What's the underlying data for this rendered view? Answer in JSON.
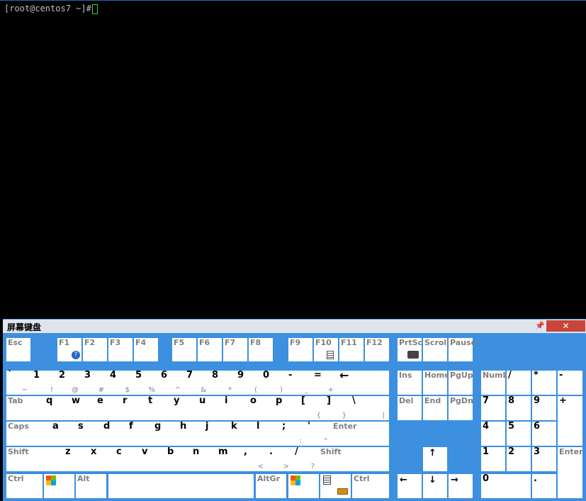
{
  "terminal": {
    "prompt": "[root@centos7 ~]#"
  },
  "osk": {
    "title": "屏幕键盘",
    "pin_icon": "📌",
    "close_icon": "✕",
    "colors": {
      "background": "#3d8fe0",
      "key": "#ffffff",
      "key_text": "#7f7f7f",
      "close": "#c7453a"
    },
    "keys": {
      "esc": "Esc",
      "f1": "F1",
      "f2": "F2",
      "f3": "F3",
      "f4": "F4",
      "f5": "F5",
      "f6": "F6",
      "f7": "F7",
      "f8": "F8",
      "f9": "F9",
      "f10": "F10",
      "f11": "F11",
      "f12": "F12",
      "prtsc": "PrtSc",
      "scroll": "Scroll",
      "pause": "Pause",
      "backtick": "`",
      "tilde": "~",
      "n1": "1",
      "n1s": "!",
      "n2": "2",
      "n2s": "@",
      "n3": "3",
      "n3s": "#",
      "n4": "4",
      "n4s": "$",
      "n5": "5",
      "n5s": "%",
      "n6": "6",
      "n6s": "^",
      "n7": "7",
      "n7s": "&",
      "n8": "8",
      "n8s": "*",
      "n9": "9",
      "n9s": "(",
      "n0": "0",
      "n0s": ")",
      "minus": "-",
      "minus_s": "_",
      "equal": "=",
      "equal_s": "+",
      "backspace": "←",
      "ins": "Ins",
      "home": "Home",
      "pgup": "PgUp",
      "numl": "NumL",
      "np_div": "/",
      "np_mul": "*",
      "np_sub": "-",
      "tab": "Tab",
      "q": "q",
      "w": "w",
      "e": "e",
      "r": "r",
      "t": "t",
      "y": "y",
      "u": "u",
      "i": "i",
      "o": "o",
      "p": "p",
      "lbr": "[",
      "lbr_s": "{",
      "rbr": "]",
      "rbr_s": "}",
      "bslash": "\\",
      "bslash_s": "|",
      "del": "Del",
      "end": "End",
      "pgdn": "PgDn",
      "np7": "7",
      "np8": "8",
      "np9": "9",
      "np_add": "+",
      "caps": "Caps",
      "a": "a",
      "s": "s",
      "d": "d",
      "f": "f",
      "g": "g",
      "h": "h",
      "j": "j",
      "k": "k",
      "l": "l",
      "semi": ";",
      "semi_s": ":",
      "quote": "'",
      "quote_s": "\"",
      "enter": "Enter",
      "np4": "4",
      "np5": "5",
      "np6": "6",
      "shift_l": "Shift",
      "z": "z",
      "x": "x",
      "c": "c",
      "v": "v",
      "b": "b",
      "n": "n",
      "m": "m",
      "comma": ",",
      "comma_s": "<",
      "period": ".",
      "period_s": ">",
      "slash": "/",
      "slash_s": "?",
      "shift_r": "Shift",
      "arrow_up": "↑",
      "np1": "1",
      "np2": "2",
      "np3": "3",
      "np_enter": "Enter",
      "ctrl_l": "Ctrl",
      "alt": "Alt",
      "altgr": "AltGr",
      "ctrl_r": "Ctrl",
      "arrow_left": "←",
      "arrow_down": "↓",
      "arrow_right": "→",
      "np0": "0",
      "np_dot": "."
    }
  }
}
